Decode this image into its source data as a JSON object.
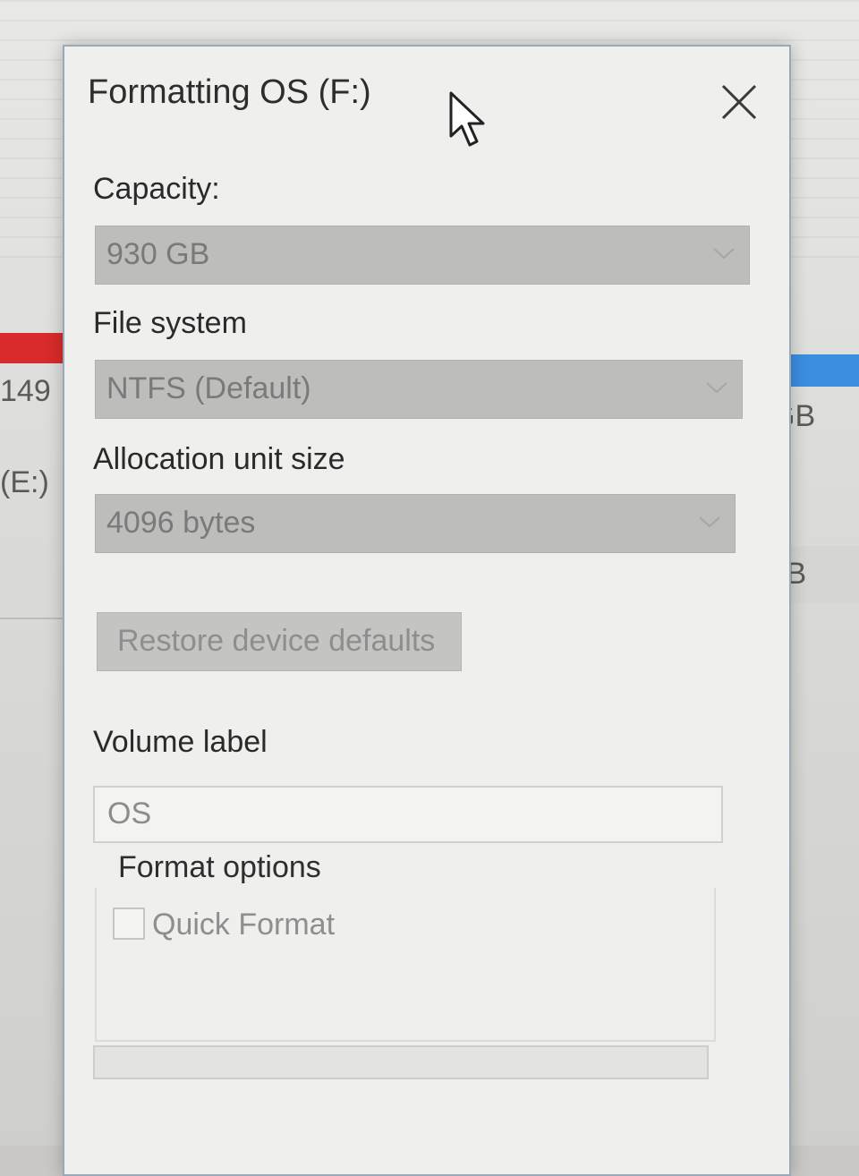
{
  "dialog": {
    "title": "Formatting OS (F:)",
    "close_icon": "close-icon",
    "capacity": {
      "label": "Capacity:",
      "value": "930 GB"
    },
    "file_system": {
      "label": "File system",
      "value": "NTFS (Default)"
    },
    "allocation": {
      "label": "Allocation unit size",
      "value": "4096 bytes"
    },
    "restore_label": "Restore device defaults",
    "volume": {
      "label": "Volume label",
      "value": "OS"
    },
    "format_options": {
      "label": "Format options",
      "quick_format_label": "Quick Format",
      "quick_format_checked": false
    },
    "progress": 0
  },
  "background": {
    "left_number": "149",
    "left_drive": "(E:)",
    "right_unit_1": "GB",
    "right_unit_2": "GB"
  },
  "colors": {
    "dialog_bg": "#efefed",
    "disabled_field": "#bdbdbb",
    "drive_bar_red": "#d92b2b",
    "drive_bar_blue": "#3b8ee0"
  }
}
